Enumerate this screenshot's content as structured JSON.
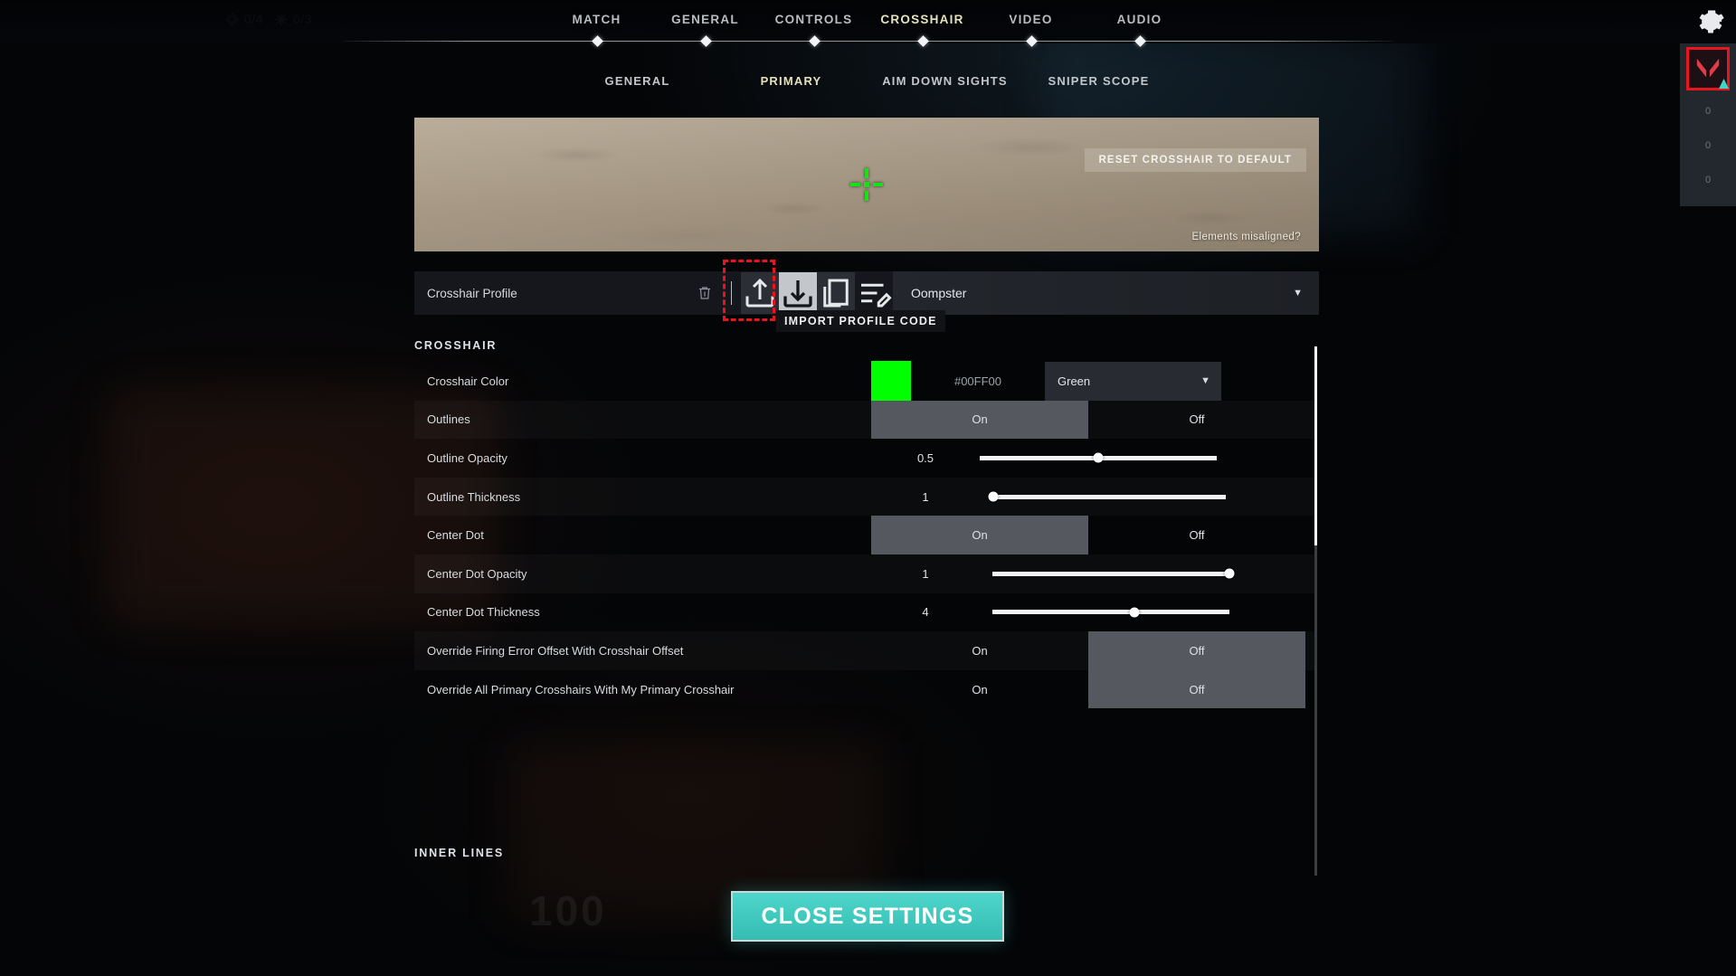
{
  "hud": {
    "counters": [
      {
        "icon": "spike-icon",
        "value": "0/4"
      },
      {
        "icon": "burst-icon",
        "value": "0/3"
      }
    ]
  },
  "main_tabs": {
    "items": [
      {
        "label": "MATCH",
        "active": false
      },
      {
        "label": "GENERAL",
        "active": false
      },
      {
        "label": "CONTROLS",
        "active": false
      },
      {
        "label": "CROSSHAIR",
        "active": true
      },
      {
        "label": "VIDEO",
        "active": false
      },
      {
        "label": "AUDIO",
        "active": false
      }
    ],
    "active_color": "#e6e2bd"
  },
  "sub_tabs": {
    "items": [
      {
        "label": "GENERAL",
        "active": false
      },
      {
        "label": "PRIMARY",
        "active": true
      },
      {
        "label": "AIM DOWN SIGHTS",
        "active": false
      },
      {
        "label": "SNIPER SCOPE",
        "active": false
      }
    ]
  },
  "preview": {
    "reset_button": "RESET CROSSHAIR TO DEFAULT",
    "misaligned_link": "Elements misaligned?",
    "crosshair_color": "#00FF00",
    "wall_color": "#ab9d88"
  },
  "profile_bar": {
    "label": "Crosshair Profile",
    "selected_profile": "Oompster",
    "caret": "▼",
    "icons": [
      {
        "name": "trash-icon",
        "state": "normal"
      },
      {
        "name": "export-icon",
        "state": "normal"
      },
      {
        "name": "import-icon",
        "state": "active"
      },
      {
        "name": "duplicate-icon",
        "state": "normal"
      },
      {
        "name": "rename-icon",
        "state": "normal"
      }
    ],
    "tooltip": "IMPORT PROFILE CODE",
    "annotation_color": "#e8141e"
  },
  "sections": {
    "crosshair_title": "CROSSHAIR",
    "inner_lines_title": "INNER LINES"
  },
  "settings_rows": [
    {
      "label": "Crosshair Color",
      "type": "color",
      "swatch": "#00FF00",
      "hex": "#00FF00",
      "selected": "Green",
      "caret": "▼"
    },
    {
      "label": "Outlines",
      "type": "toggle",
      "on_label": "On",
      "off_label": "Off",
      "value": "On"
    },
    {
      "label": "Outline Opacity",
      "type": "slider",
      "value": "0.5",
      "percent": 50
    },
    {
      "label": "Outline Thickness",
      "type": "slider",
      "value": "1",
      "percent": 2
    },
    {
      "label": "Center Dot",
      "type": "toggle",
      "on_label": "On",
      "off_label": "Off",
      "value": "On"
    },
    {
      "label": "Center Dot Opacity",
      "type": "slider",
      "value": "1",
      "percent": 100
    },
    {
      "label": "Center Dot Thickness",
      "type": "slider",
      "value": "4",
      "percent": 60
    },
    {
      "label": "Override Firing Error Offset With Crosshair Offset",
      "type": "toggle",
      "on_label": "On",
      "off_label": "Off",
      "value": "Off"
    },
    {
      "label": "Override All Primary Crosshairs With My Primary Crosshair",
      "type": "toggle",
      "on_label": "On",
      "off_label": "Off",
      "value": "Off"
    }
  ],
  "footer": {
    "close_label": "CLOSE SETTINGS",
    "close_color": "#3fc8bd"
  },
  "right_rail": {
    "app_icon": "valorant-logo-icon",
    "highlight_color": "#e8141e",
    "items": [
      {
        "label": "0"
      },
      {
        "label": "0"
      },
      {
        "label": "0"
      }
    ]
  },
  "background": {
    "ghost_number": "100"
  }
}
